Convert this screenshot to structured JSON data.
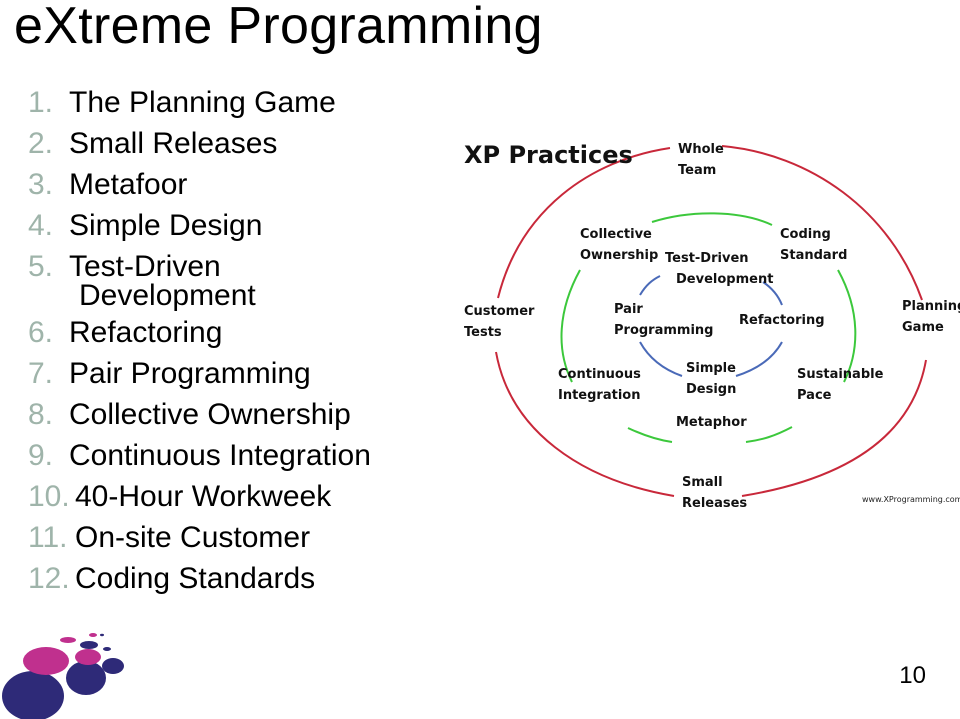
{
  "slide": {
    "title": "eXtreme Programming",
    "page_number": "10"
  },
  "practices_list": [
    {
      "num": "1.",
      "text": "The Planning Game"
    },
    {
      "num": "2.",
      "text": "Small Releases"
    },
    {
      "num": "3.",
      "text": "Metafoor"
    },
    {
      "num": "4.",
      "text": "Simple Design"
    },
    {
      "num": "5.",
      "text": "Test-Driven",
      "cont": "Development"
    },
    {
      "num": "6.",
      "text": "Refactoring"
    },
    {
      "num": "7.",
      "text": "Pair Programming"
    },
    {
      "num": "8.",
      "text": "Collective Ownership"
    },
    {
      "num": "9.",
      "text": "Continuous Integration"
    },
    {
      "num": "10.",
      "text": "40-Hour Workweek"
    },
    {
      "num": "11.",
      "text": "On-site Customer"
    },
    {
      "num": "12.",
      "text": "Coding Standards"
    }
  ],
  "diagram": {
    "title": "XP Practices",
    "credit": "www.XProgramming.com",
    "colors": {
      "outer": "#c8283a",
      "middle": "#3cc83c",
      "inner": "#4a6ab8"
    },
    "outer_ring": {
      "top_l1": "Whole",
      "top_l2": "Team",
      "left_l1": "Customer",
      "left_l2": "Tests",
      "right_l1": "Planning",
      "right_l2": "Game",
      "bottom_l1": "Small",
      "bottom_l2": "Releases"
    },
    "middle_ring": {
      "tl_l1": "Collective",
      "tl_l2": "Ownership",
      "tr_l1": "Coding",
      "tr_l2": "Standard",
      "bl_l1": "Continuous",
      "bl_l2": "Integration",
      "br_l1": "Sustainable",
      "br_l2": "Pace",
      "bottom": "Metaphor"
    },
    "inner_ring": {
      "top_l1": "Test-Driven",
      "top_l2": "Development",
      "left_l1": "Pair",
      "left_l2": "Programming",
      "right": "Refactoring",
      "bottom_l1": "Simple",
      "bottom_l2": "Design"
    }
  },
  "logo": {
    "colors": {
      "navy": "#2e2a78",
      "magenta": "#c0308e"
    }
  }
}
